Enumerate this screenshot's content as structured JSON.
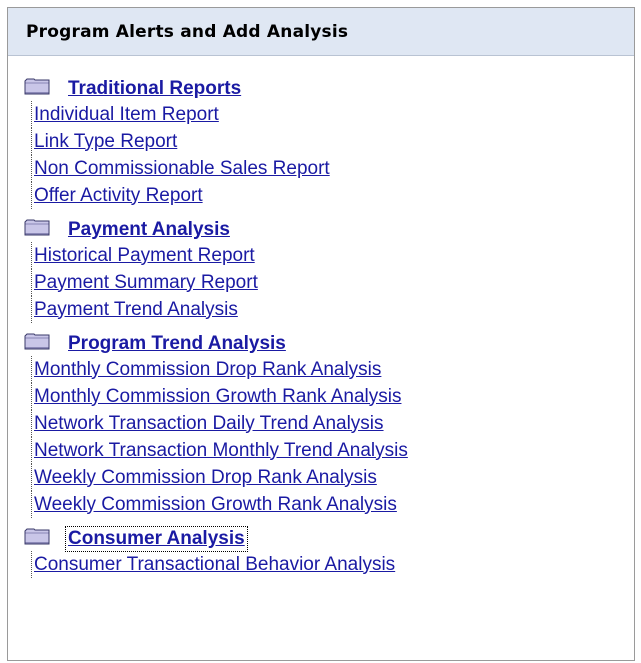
{
  "panel": {
    "title": "Program Alerts and Add Analysis"
  },
  "groups": [
    {
      "title": "Traditional Reports",
      "items": [
        "Individual Item Report",
        "Link Type Report",
        "Non Commissionable Sales Report",
        "Offer Activity Report"
      ]
    },
    {
      "title": "Payment Analysis",
      "items": [
        "Historical Payment Report",
        "Payment Summary Report",
        "Payment Trend Analysis"
      ]
    },
    {
      "title": "Program Trend Analysis",
      "items": [
        "Monthly Commission Drop Rank Analysis",
        "Monthly Commission Growth Rank Analysis",
        "Network Transaction Daily Trend Analysis",
        "Network Transaction Monthly Trend Analysis",
        "Weekly Commission Drop Rank Analysis",
        "Weekly Commission Growth Rank Analysis"
      ]
    },
    {
      "title": "Consumer Analysis",
      "focused": true,
      "items": [
        "Consumer Transactional Behavior Analysis"
      ]
    }
  ],
  "colors": {
    "link": "#1a1aa3",
    "header_bg": "#dfe7f3",
    "folder": "#c9c6e8"
  },
  "icons": {
    "folder": "folder-icon"
  }
}
